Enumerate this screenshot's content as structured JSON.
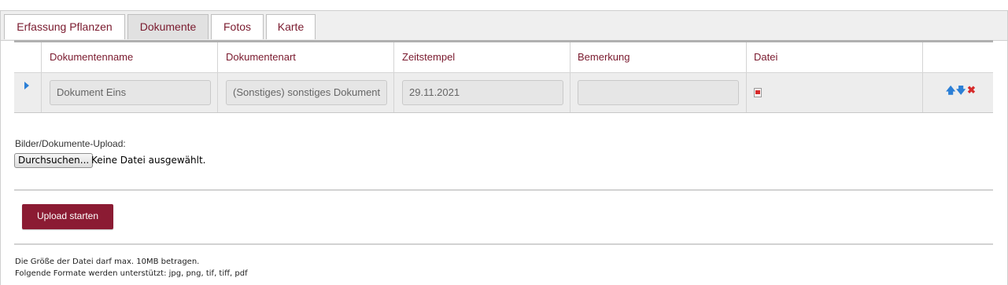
{
  "tabs": [
    {
      "label": "Erfassung Pflanzen",
      "active": false
    },
    {
      "label": "Dokumente",
      "active": true
    },
    {
      "label": "Fotos",
      "active": false
    },
    {
      "label": "Karte",
      "active": false
    }
  ],
  "grid": {
    "columns": [
      "Dokumentenname",
      "Dokumentenart",
      "Zeitstempel",
      "Bemerkung",
      "Datei"
    ],
    "rows": [
      {
        "name": "Dokument Eins",
        "type": "(Sonstiges) sonstiges Dokument",
        "timestamp": "29.11.2021",
        "remark": "",
        "file_icon": "pdf-icon",
        "actions": [
          "move-up-icon",
          "move-down-icon",
          "delete-icon"
        ]
      }
    ]
  },
  "upload": {
    "label": "Bilder/Dokumente-Upload:",
    "browse_button": "Durchsuchen...",
    "no_file_text": "Keine Datei ausgewählt.",
    "start_button": "Upload starten"
  },
  "notes": [
    "Die Größe der Datei darf max. 10MB betragen.",
    "Folgende Formate werden unterstützt: jpg, png, tif, tiff, pdf"
  ],
  "colors": {
    "accent": "#7a1a2e",
    "button_bg": "#8b1b33",
    "arrow_blue": "#2b7fd6",
    "delete_red": "#d62b2b"
  }
}
